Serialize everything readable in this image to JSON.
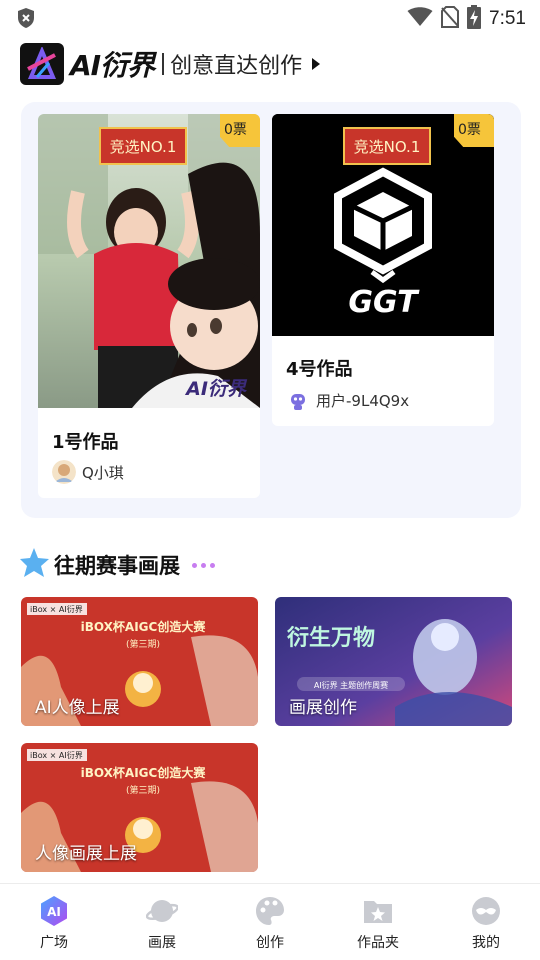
{
  "status_bar": {
    "time": "7:51",
    "icons": [
      "shield-icon",
      "wifi-icon",
      "no-sim-icon",
      "battery-charging-icon"
    ]
  },
  "header": {
    "logo_text": "AI衍界",
    "slogan": "创意直达创作"
  },
  "featured": {
    "works": [
      {
        "title": "1号作品",
        "votes": "0票",
        "author": "Q小琪",
        "stamp": "竞选NO.1",
        "watermark": "AI衍界"
      },
      {
        "title": "4号作品",
        "votes": "0票",
        "author": "用户-9L4Q9x",
        "stamp": "竞选NO.1",
        "logo_caption": "GGT"
      }
    ]
  },
  "past_events": {
    "title": "往期赛事画展",
    "items": [
      {
        "label": "AI人像上展",
        "poster_title": "iBOX杯AIGC创造大赛",
        "poster_sub": "(第三期)",
        "brand": "iBox × AI衍界"
      },
      {
        "label": "画展创作",
        "poster_title": "衍生万物",
        "poster_sub": "AI衍界 主题创作周赛"
      },
      {
        "label": "人像画展上展",
        "poster_title": "iBOX杯AIGC创造大赛",
        "poster_sub": "(第三期)",
        "brand": "iBox × AI衍界"
      }
    ]
  },
  "bottom_nav": {
    "items": [
      {
        "label": "广场",
        "icon": "ai-hexagon-icon",
        "active": true
      },
      {
        "label": "画展",
        "icon": "planet-icon",
        "active": false
      },
      {
        "label": "创作",
        "icon": "palette-icon",
        "active": false
      },
      {
        "label": "作品夹",
        "icon": "folder-star-icon",
        "active": false
      },
      {
        "label": "我的",
        "icon": "mask-icon",
        "active": false
      }
    ]
  },
  "colors": {
    "accent_purple": "#7b5cf0",
    "badge_yellow": "#f6c53a",
    "panel_bg": "#f3f5fd",
    "poster_red": "#c8352a"
  }
}
